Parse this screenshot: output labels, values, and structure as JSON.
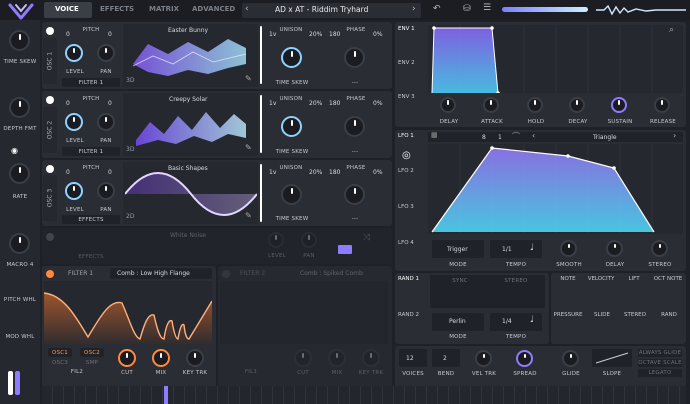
{
  "header": {
    "tabs": [
      {
        "label": "VOICE"
      },
      {
        "label": "EFFECTS"
      },
      {
        "label": "MATRIX"
      },
      {
        "label": "ADVANCED"
      }
    ],
    "preset_name": "AD x AT -  Riddim Tryhard",
    "accent": "#8f7bff"
  },
  "macros": [
    {
      "label": "TIME SKEW"
    },
    {
      "label": "DEPTH FMT"
    },
    {
      "label": "RATE"
    },
    {
      "label": "MACRO 4"
    },
    {
      "label": "PITCH WHL"
    },
    {
      "label": "MOD WHL"
    }
  ],
  "oscillators": [
    {
      "side": "OSC 1",
      "pitch_a": "0",
      "pitch_b": "0",
      "level_label": "LEVEL",
      "pan_label": "PAN",
      "route": "FILTER 1",
      "wavetable": "Easter Bunny",
      "dim": "3D",
      "unison_voices": "1v",
      "unison_label": "UNISON",
      "unison_amount": "20%",
      "phase_value": "180",
      "phase_label": "PHASE",
      "phase_amount": "0%",
      "time_skew": "TIME SKEW",
      "phase_mode": "---"
    },
    {
      "side": "OSC 2",
      "pitch_a": "0",
      "pitch_b": "0",
      "level_label": "LEVEL",
      "pan_label": "PAN",
      "route": "FILTER 1",
      "wavetable": "Creepy Solar",
      "dim": "3D",
      "unison_voices": "1v",
      "unison_label": "UNISON",
      "unison_amount": "20%",
      "phase_value": "180",
      "phase_label": "PHASE",
      "phase_amount": "0%",
      "time_skew": "TIME SKEW",
      "phase_mode": "---"
    },
    {
      "side": "OSC 3",
      "pitch_a": "0",
      "pitch_b": "0",
      "level_label": "LEVEL",
      "pan_label": "PAN",
      "route": "EFFECTS",
      "wavetable": "Basic Shapes",
      "dim": "2D",
      "unison_voices": "1v",
      "unison_label": "UNISON",
      "unison_amount": "20%",
      "phase_value": "180",
      "phase_label": "PHASE",
      "phase_amount": "0%",
      "time_skew": "TIME SKEW",
      "phase_mode": "---"
    }
  ],
  "pitch_label": "PITCH",
  "sampler": {
    "route": "EFFECTS",
    "name": "White Noise",
    "level_label": "LEVEL",
    "pan_label": "PAN"
  },
  "filter1": {
    "title": "FILTER 1",
    "type": "Comb : Low High Flange",
    "osc1": "OSC1",
    "osc2": "OSC2",
    "sample": "SMP",
    "osc3": "OSC3",
    "route": "FIL2",
    "cut": "CUT",
    "mix": "MIX",
    "keytrk": "KEY TRK"
  },
  "filter2": {
    "title": "FILTER 2",
    "type": "Comb : Spiked Comb",
    "route": "FIL1",
    "cut": "CUT",
    "mix": "MIX",
    "keytrk": "KEY TRK"
  },
  "envelopes": {
    "labels": [
      "ENV 1",
      "ENV 2",
      "ENV 3"
    ],
    "knobs": [
      "DELAY",
      "ATTACK",
      "HOLD",
      "DECAY",
      "SUSTAIN",
      "RELEASE"
    ]
  },
  "lfo": {
    "labels": [
      "LFO 1",
      "LFO 2",
      "LFO 3",
      "LFO 4"
    ],
    "beats": "8",
    "num": "1",
    "shape": "Triangle",
    "mode": "Trigger",
    "mode_label": "MODE",
    "tempo": "1/1",
    "tempo_label": "TEMPO",
    "smooth": "SMOOTH",
    "delay": "DELAY",
    "stereo": "STEREO"
  },
  "random": {
    "labels": [
      "RAND 1",
      "RAND 2"
    ],
    "sync": "SYNC",
    "stereo": "STEREO",
    "mode": "Perlin",
    "mode_label": "MODE",
    "tempo": "1/4",
    "tempo_label": "TEMPO"
  },
  "mod_grid": {
    "row1": [
      "NOTE",
      "VELOCITY",
      "LIFT",
      "OCT NOTE"
    ],
    "row2": [
      "PRESSURE",
      "SLIDE",
      "STEREO",
      "RAND"
    ]
  },
  "voice": {
    "voices": "12",
    "voices_label": "VOICES",
    "bend": "2",
    "bend_label": "BEND",
    "vel_trk": "VEL TRK",
    "spread": "SPREAD",
    "glide": "GLIDE",
    "slope": "SLOPE",
    "always_glide": "ALWAYS GLIDE",
    "octave_scale": "OCTAVE SCALE",
    "legato": "LEGATO"
  }
}
